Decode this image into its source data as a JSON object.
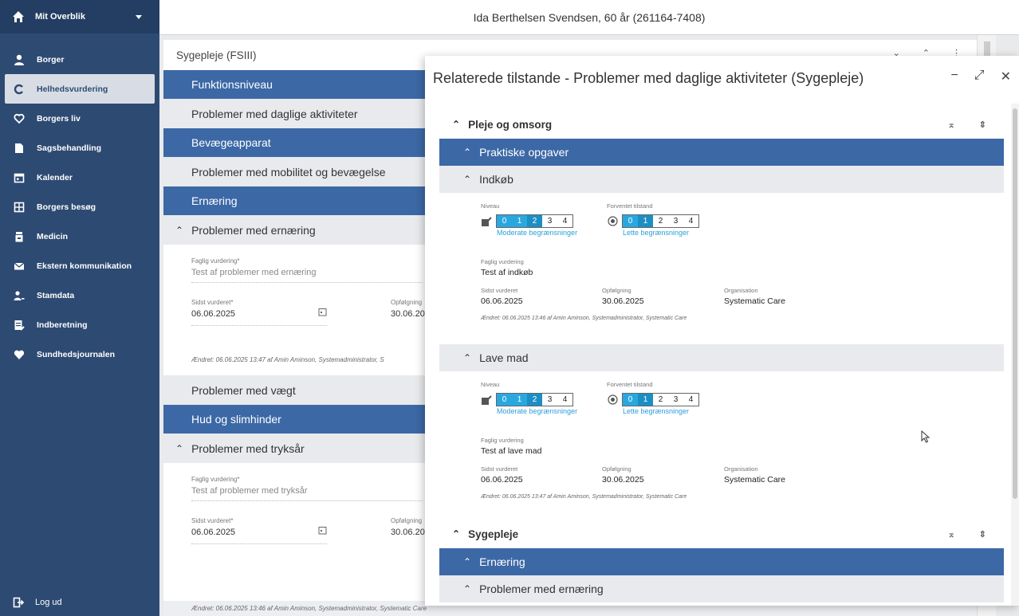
{
  "sidebar": {
    "title": "Mit Overblik",
    "items": [
      {
        "label": "Borger",
        "icon": "person-icon"
      },
      {
        "label": "Helhedsvurdering",
        "icon": "cycle-icon"
      },
      {
        "label": "Borgers liv",
        "icon": "heart-outline-icon"
      },
      {
        "label": "Sagsbehandling",
        "icon": "folder-icon"
      },
      {
        "label": "Kalender",
        "icon": "calendar-icon"
      },
      {
        "label": "Borgers besøg",
        "icon": "visits-icon"
      },
      {
        "label": "Medicin",
        "icon": "pill-bottle-icon"
      },
      {
        "label": "Ekstern kommunikation",
        "icon": "envelope-icon"
      },
      {
        "label": "Stamdata",
        "icon": "person-data-icon"
      },
      {
        "label": "Indberetning",
        "icon": "report-icon"
      },
      {
        "label": "Sundhedsjournalen",
        "icon": "heart-icon"
      }
    ],
    "logout": "Log ud"
  },
  "header": {
    "patient": "Ida Berthelsen Svendsen, 60 år (261164-7408)"
  },
  "main": {
    "panel_title": "Sygepleje (FSIII)",
    "rows": {
      "r1": "Funktionsniveau",
      "r2": "Problemer med daglige aktiviteter",
      "r3": "Bevægeapparat",
      "r4": "Problemer med mobilitet og bevægelse",
      "r5": "Ernæring",
      "r6": "Problemer med ernæring",
      "r7": "Problemer med vægt",
      "r8": "Hud og slimhinder",
      "r9": "Problemer med tryksår"
    },
    "ernaering": {
      "faglig_label": "Faglig vurdering*",
      "faglig_value": "Test af problemer med ernæring",
      "sidst_label": "Sidst vurderet*",
      "sidst_value": "06.06.2025",
      "opf_label": "Opfølgning",
      "opf_value": "30.06.20",
      "edited": "Ændret: 06.06.2025 13:47 af Amin Aminson, Systemadministrator, S"
    },
    "tryksaar": {
      "faglig_label": "Faglig vurdering*",
      "faglig_value": "Test af problemer med tryksår",
      "sidst_label": "Sidst vurderet*",
      "sidst_value": "06.06.2025",
      "opf_label": "Opfølgning",
      "opf_value": "30.06.20",
      "edited": "Ændret: 06.06.2025 13:46 af Amin Aminson, Systemadministrator, Systematic Care"
    }
  },
  "modal": {
    "title": "Relaterede tilstande - Problemer med daglige aktiviteter (Sygepleje)",
    "section1": "Pleje og omsorg",
    "group1": "Praktiske opgaver",
    "entries": [
      {
        "heading": "Indkøb",
        "niveau_label": "Niveau",
        "niveau_caption": "Moderate begrænsninger",
        "forventet_label": "Forventet tilstand",
        "forventet_caption": "Lette begrænsninger",
        "faglig_label": "Faglig vurdering",
        "faglig_value": "Test af indkøb",
        "sidst_label": "Sidst vurderet",
        "sidst_value": "06.06.2025",
        "opf_label": "Opfølgning",
        "opf_value": "30.06.2025",
        "org_label": "Organisation",
        "org_value": "Systematic Care",
        "edited": "Ændret: 06.06.2025 13:46 af Amin Aminson, Systemadministrator, Systematic Care"
      },
      {
        "heading": "Lave mad",
        "niveau_label": "Niveau",
        "niveau_caption": "Moderate begrænsninger",
        "forventet_label": "Forventet tilstand",
        "forventet_caption": "Lette begrænsninger",
        "faglig_label": "Faglig vurdering",
        "faglig_value": "Test af lave mad",
        "sidst_label": "Sidst vurderet",
        "sidst_value": "06.06.2025",
        "opf_label": "Opfølgning",
        "opf_value": "30.06.2025",
        "org_label": "Organisation",
        "org_value": "Systematic Care",
        "edited": "Ændret: 06.06.2025 13:47 af Amin Aminson, Systemadministrator, Systematic Care"
      }
    ],
    "section2": "Sygepleje",
    "group2": "Ernæring",
    "group3": "Problemer med ernæring",
    "scale": [
      "0",
      "1",
      "2",
      "3",
      "4"
    ],
    "niveau_level": 2,
    "forventet_level": 1
  },
  "colors": {
    "sidebar": "#2d4a72",
    "bar_blue": "#3c68a6",
    "scale_fill": "#29a8e0"
  }
}
